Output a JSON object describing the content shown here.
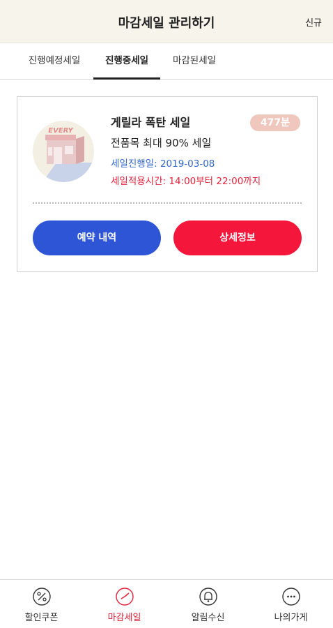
{
  "header": {
    "title": "마감세일 관리하기",
    "new_label": "신규"
  },
  "tabs": [
    {
      "label": "진행예정세일",
      "active": false
    },
    {
      "label": "진행중세일",
      "active": true
    },
    {
      "label": "마감된세일",
      "active": false
    }
  ],
  "sale_card": {
    "thumbnail_sign": "EVERY",
    "title": "게릴라 폭탄 세일",
    "badge": "477분",
    "subtitle": "전품목 최대 90% 세일",
    "date_text": "세일진행일: 2019-03-08",
    "time_text": "세일적용시간: 14:00부터 22:00까지",
    "reserve_button": "예약 내역",
    "detail_button": "상세정보"
  },
  "bottom_nav": [
    {
      "label": "할인쿠폰",
      "icon": "percent-icon",
      "active": false
    },
    {
      "label": "마감세일",
      "icon": "clock-icon",
      "active": true
    },
    {
      "label": "알림수신",
      "icon": "bell-icon",
      "active": false
    },
    {
      "label": "나의가게",
      "icon": "more-icon",
      "active": false
    }
  ],
  "colors": {
    "header_bg": "#f7f4ec",
    "reserve_button": "#2d55d6",
    "detail_button": "#f4163b",
    "badge": "#efc7bd",
    "date_text": "#3366cc",
    "time_text": "#e2243c",
    "active_nav": "#e2243c"
  }
}
